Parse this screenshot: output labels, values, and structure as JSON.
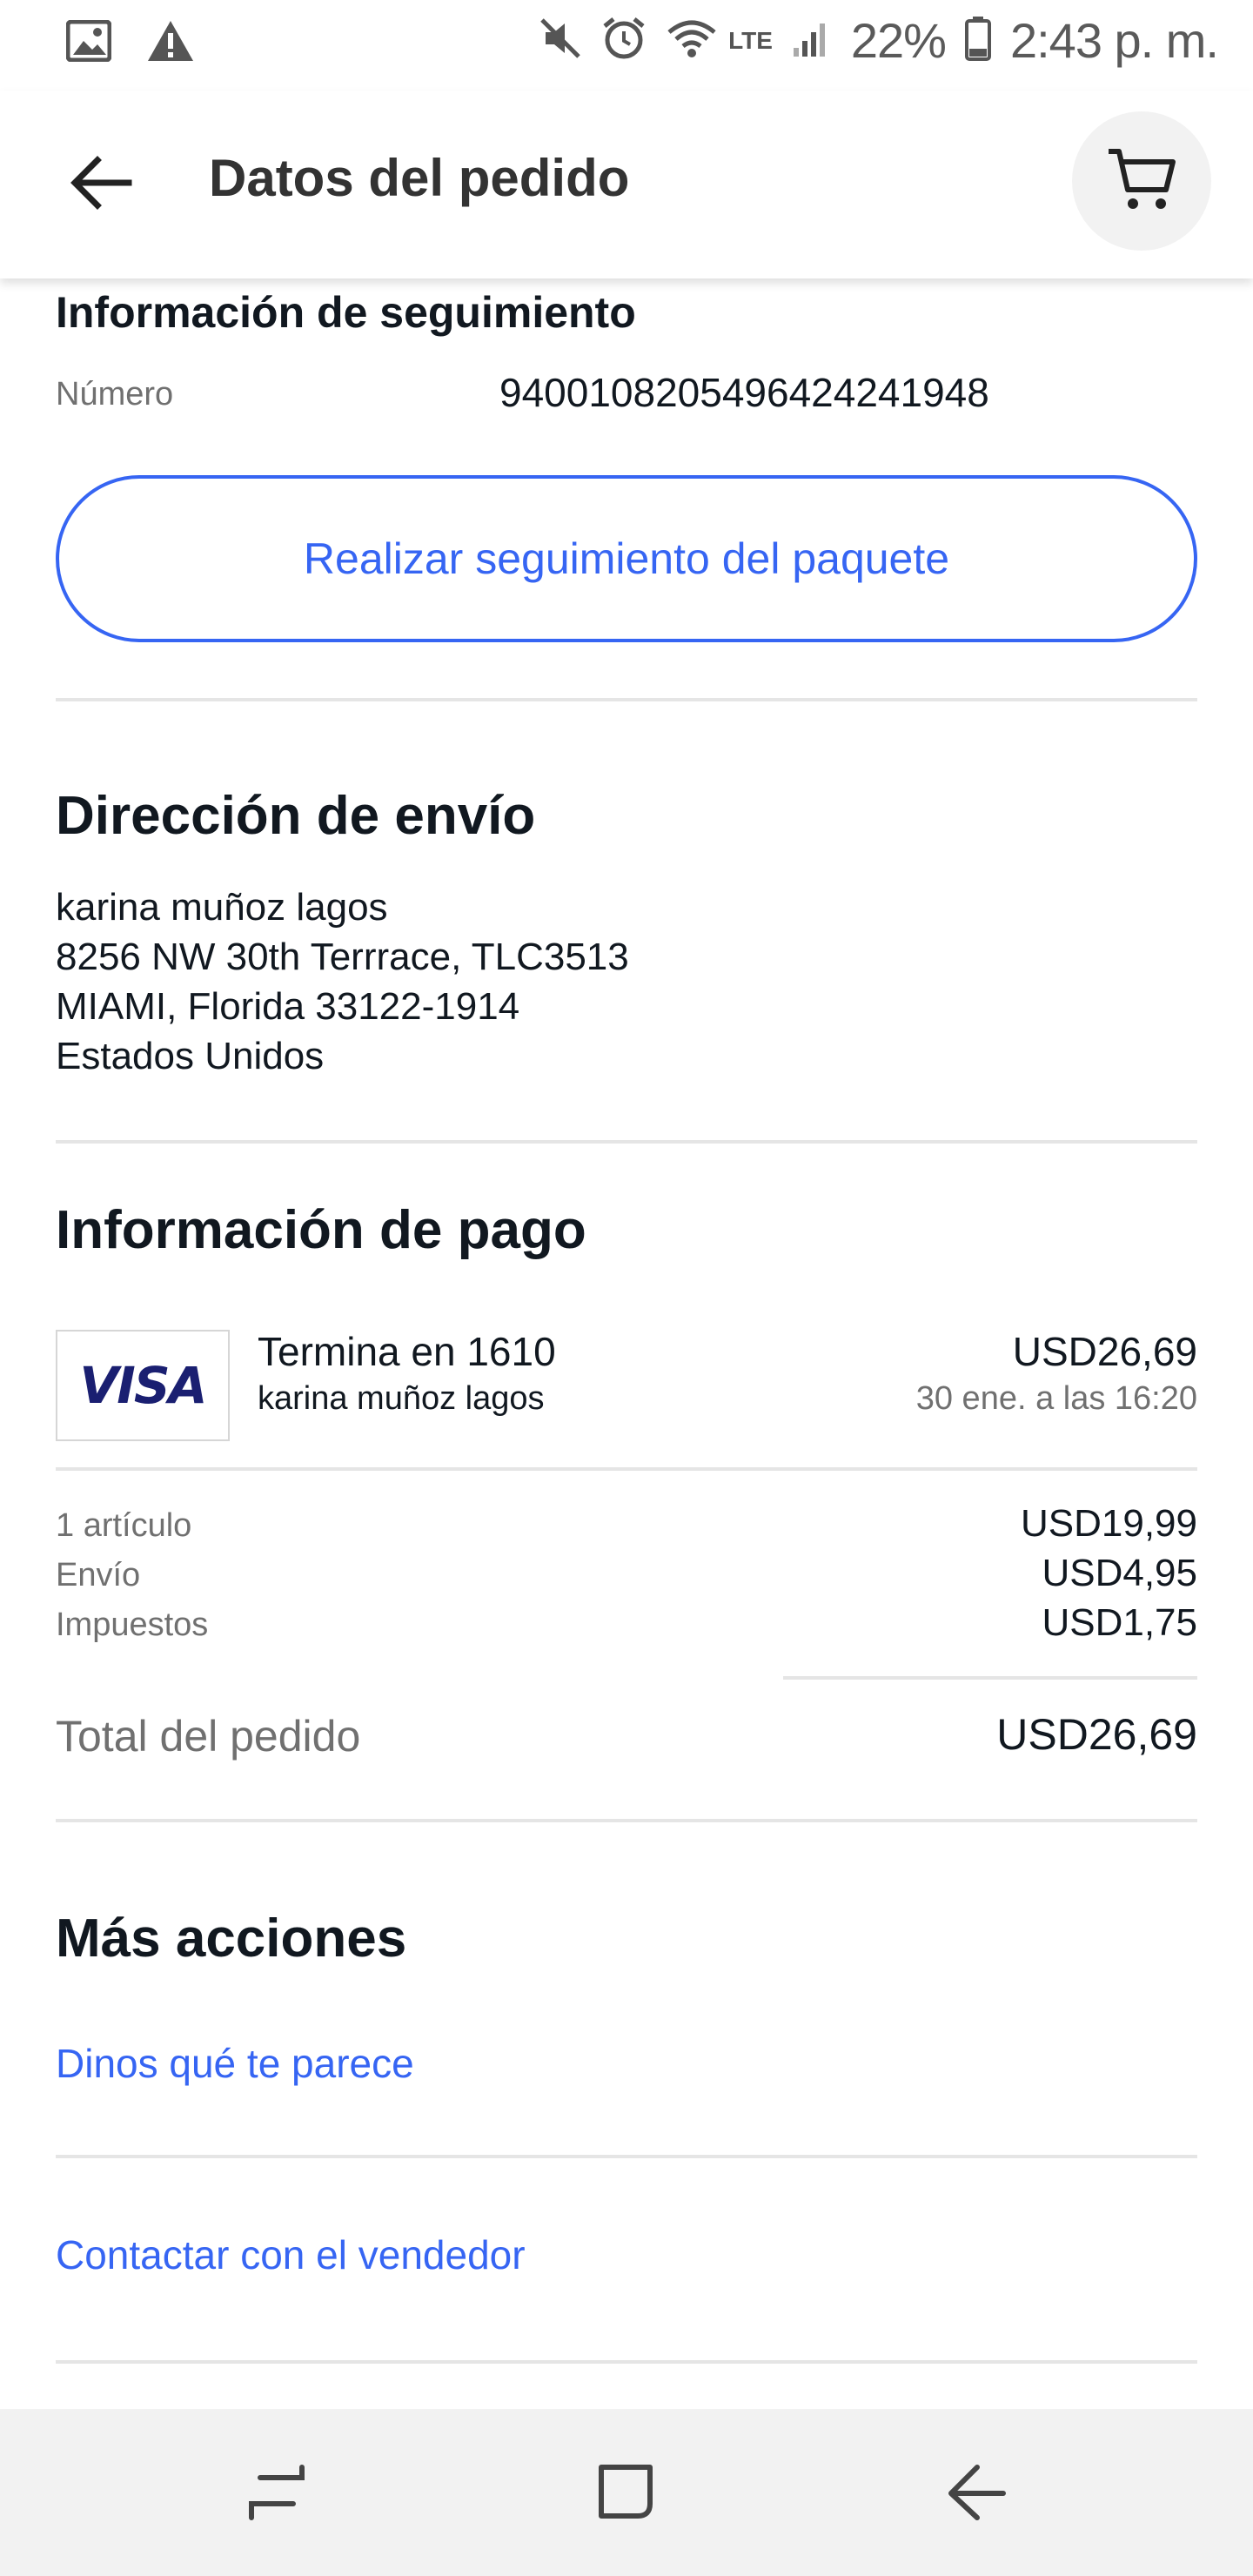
{
  "status_bar": {
    "battery_text": "22%",
    "time": "2:43 p. m.",
    "network_label": "LTE",
    "icons_left": [
      "image-icon",
      "warning-icon"
    ],
    "icons_right": [
      "mute-icon",
      "alarm-icon",
      "wifi-icon",
      "signal-icon",
      "battery-icon"
    ]
  },
  "app_bar": {
    "title": "Datos del pedido",
    "back_icon": "arrow-left-icon",
    "cart_icon": "cart-icon"
  },
  "tracking": {
    "heading": "Información de seguimiento",
    "number_label": "Número",
    "number_value": "9400108205496424241948",
    "track_button_label": "Realizar seguimiento del paquete"
  },
  "shipping": {
    "heading": "Dirección de envío",
    "lines": [
      "karina muñoz lagos",
      "8256 NW 30th Terrrace, TLC3513",
      "MIAMI, Florida 33122-1914",
      "Estados Unidos"
    ]
  },
  "payment": {
    "heading": "Información de pago",
    "card_brand": "VISA",
    "card_ending": "Termina en 1610",
    "card_holder": "karina muñoz lagos",
    "amount": "USD26,69",
    "date": "30 ene. a las 16:20",
    "lines": [
      {
        "label": "1 artículo",
        "value": "USD19,99"
      },
      {
        "label": "Envío",
        "value": "USD4,95"
      },
      {
        "label": "Impuestos",
        "value": "USD1,75"
      }
    ],
    "total_label": "Total del pedido",
    "total_value": "USD26,69"
  },
  "more_actions": {
    "heading": "Más acciones",
    "links": [
      "Dinos qué te parece",
      "Contactar con el vendedor"
    ]
  },
  "nav_bar": {
    "icons": [
      "recent-apps-icon",
      "home-icon",
      "back-icon"
    ]
  },
  "colors": {
    "accent": "#3665f3",
    "text": "#111820",
    "muted": "#707070",
    "visa_blue": "#1a1f71"
  }
}
